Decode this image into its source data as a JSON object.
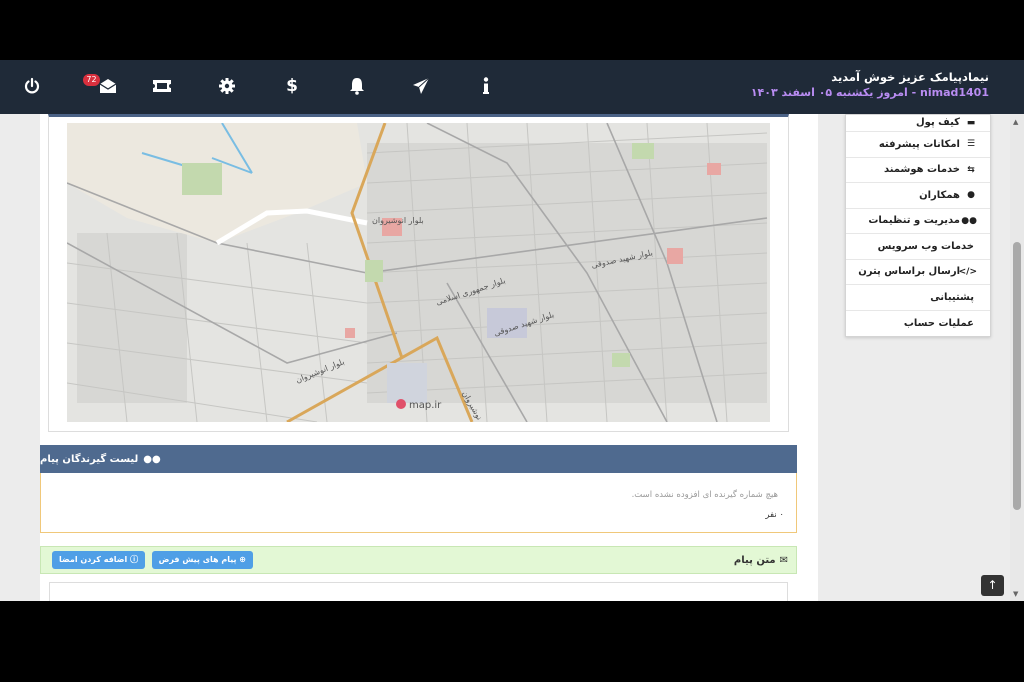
{
  "header": {
    "welcome": "نیمادپیامک عزیز خوش آمدید",
    "date_line": "nimad1401 - امروز یکشنبه ۰۵ اسفند ۱۴۰۳",
    "badge_count": "72",
    "icons": [
      "power-icon",
      "mail-icon",
      "ticket-icon",
      "gear-icon",
      "dollar-icon",
      "bell-icon",
      "paper-plane-icon",
      "info-icon"
    ]
  },
  "sidebar": {
    "items": [
      {
        "label": "کیف پول",
        "icon": "wallet-icon",
        "glyph": "▬"
      },
      {
        "label": "امکانات پیشرفته",
        "icon": "list-icon",
        "glyph": "☰"
      },
      {
        "label": "خدمات هوشمند",
        "icon": "retweet-icon",
        "glyph": "⇆"
      },
      {
        "label": "همکاران",
        "icon": "user-icon",
        "glyph": "●"
      },
      {
        "label": "مدیریت و تنظیمات",
        "icon": "users-icon",
        "glyph": "●●"
      },
      {
        "label": "خدمات وب سرویس",
        "icon": "",
        "glyph": ""
      },
      {
        "label": "ارسال براساس پترن",
        "icon": "code-icon",
        "glyph": "</>"
      },
      {
        "label": "پشتیبانی",
        "icon": "",
        "glyph": ""
      },
      {
        "label": "عملیات حساب",
        "icon": "",
        "glyph": ""
      }
    ]
  },
  "map": {
    "logo": "map.ir",
    "labels": [
      "بلوار جمهوری اسلامی",
      "بلوار شهید صدوقی",
      "بلوار انوشیروان",
      "بلوار انوشیروان",
      "بلوار شهید صدوقی",
      "بلوار نوشیروان"
    ]
  },
  "recipients": {
    "title": "لیست گیرندگان پیام",
    "empty_text": "هیچ شماره گیرنده ای افزوده نشده است.",
    "count_text": "۰ نفر"
  },
  "message": {
    "title": "متن پیام",
    "btn_default_messages": "پیام های پیش فرض",
    "btn_add_signature": "اضافه کردن امضا"
  },
  "colors": {
    "topbar": "#1f2a38",
    "accent_purple": "#b98cf2",
    "recip_header": "#4f6a8f",
    "msg_header": "#e3f8d5",
    "button_blue": "#4f9fe6",
    "badge_red": "#d9303e"
  }
}
